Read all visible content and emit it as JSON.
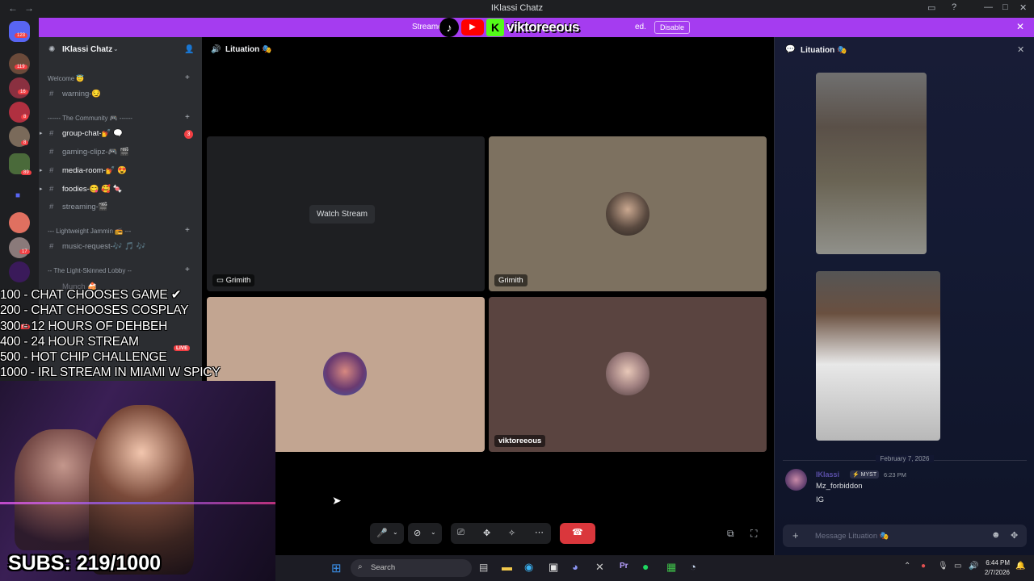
{
  "window": {
    "title": "IKlassi Chatz"
  },
  "banner": {
    "text_left": "Streame",
    "text_right": "ed.",
    "logo_text": "viktoreeous",
    "disable_label": "Disable"
  },
  "server": {
    "name": "IKlassi Chatz"
  },
  "rail_badges": [
    "123",
    "119",
    "16",
    "8",
    "8",
    "89",
    "17",
    "64"
  ],
  "sidebar": {
    "categories": [
      {
        "label": "Welcome 😇"
      },
      {
        "label": "------ The Community 🎮 ------"
      },
      {
        "label": "--- Lightweight Jammin 📻 ---"
      },
      {
        "label": "-- The Light-Skinned Lobby --"
      }
    ],
    "channels": [
      {
        "label": "warning-😏"
      },
      {
        "label": "group-chat-💅 🗨️",
        "mention": "3"
      },
      {
        "label": "gaming-clipz-🎮 🎬"
      },
      {
        "label": "media-room-💅 😍"
      },
      {
        "label": "foodies-😋 🥰 🍬"
      },
      {
        "label": "streaming-🎬"
      },
      {
        "label": "music-request-🎶 🎵 🎶"
      },
      {
        "label": "Munch 🍰"
      }
    ],
    "live_badge": "LIVE"
  },
  "voice": {
    "channel_name": "Lituation 🎭",
    "watch_stream_label": "Watch Stream",
    "tiles": [
      {
        "label": "Grimith"
      },
      {
        "label": "Grimith"
      },
      {
        "label": ""
      },
      {
        "label": "viktoreeous"
      }
    ]
  },
  "stream_overlay": {
    "goals": [
      "100 - CHAT CHOOSES GAME ✔",
      "200 - CHAT CHOOSES COSPLAY",
      "300 - 12 HOURS OF DEHBEH",
      "400 - 24 HOUR STREAM",
      "500 - HOT CHIP CHALLENGE",
      "1000 - IRL STREAM IN MIAMI W SPICY"
    ],
    "subs": "SUBS: 219/1000"
  },
  "thread": {
    "title": "Lituation 🎭",
    "date_divider": "February 7, 2026",
    "message": {
      "author": "IKlassi",
      "tag": "MYST",
      "time": "6:23 PM",
      "lines": [
        "Mz_forbiddon",
        "IG"
      ]
    },
    "composer_placeholder": "Message Lituation 🎭"
  },
  "taskbar": {
    "search_placeholder": "Search",
    "time": "6:44 PM",
    "date": "2/7/2026"
  },
  "colors": {
    "accent": "#a53cf0",
    "danger": "#da373c",
    "sidebar": "#2b2d31",
    "rail": "#1e1f22"
  }
}
